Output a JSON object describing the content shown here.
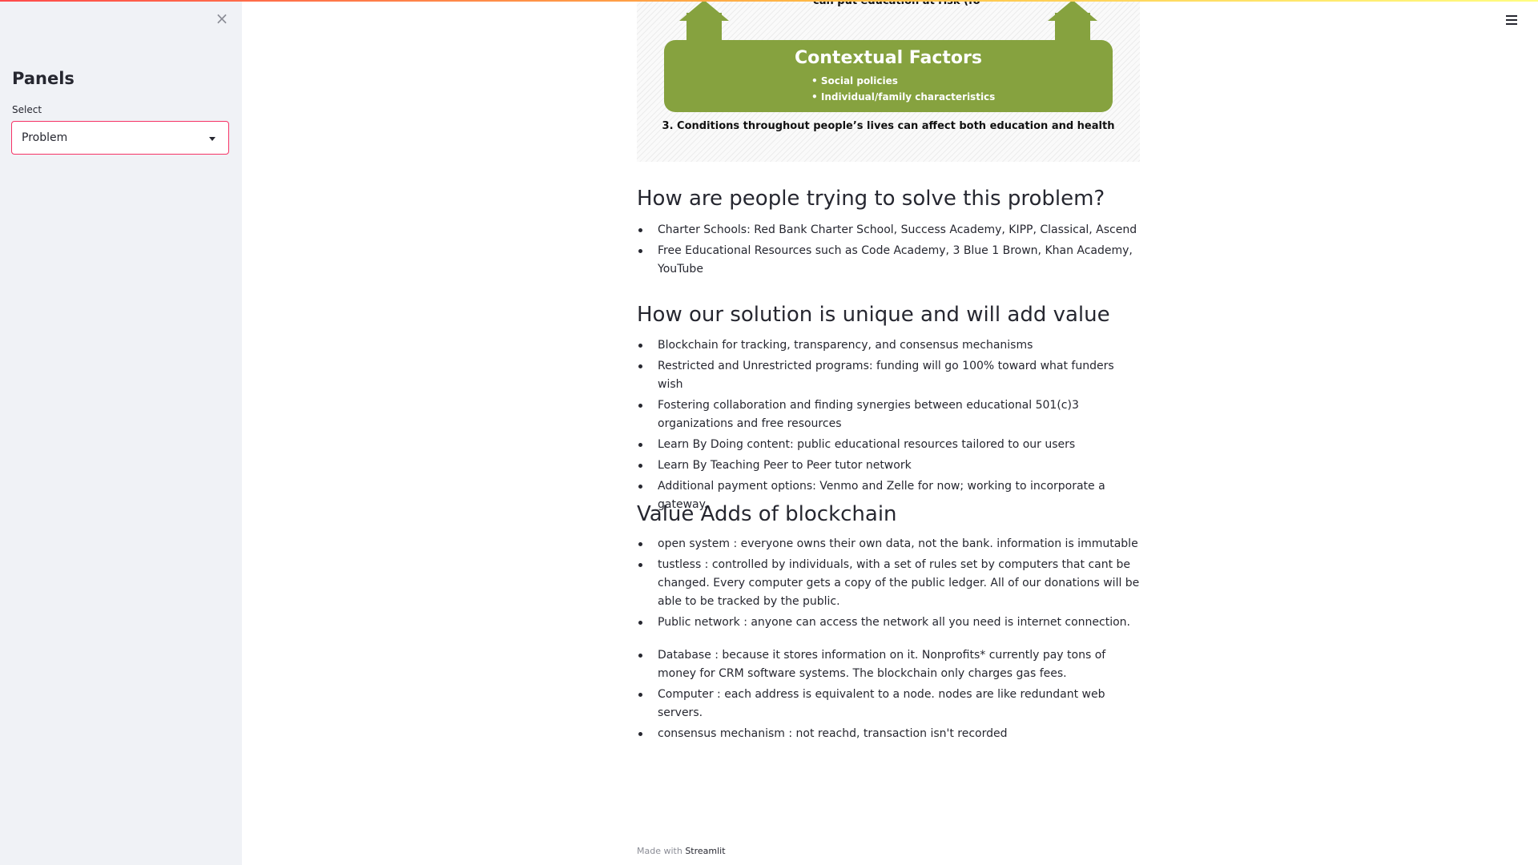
{
  "sidebar": {
    "close_icon": "×",
    "title": "Panels",
    "select_label": "Select",
    "select_value": "Problem"
  },
  "image": {
    "top_text": "can put education at risk (fo",
    "box_title": "Contextual Factors",
    "bullets": [
      "• Social policies",
      "• Individual/family characteristics"
    ],
    "caption": "3. Conditions throughout people’s lives can affect both education and health"
  },
  "sections": [
    {
      "heading": "How are people trying to solve this problem?",
      "items": [
        "Charter Schools: Red Bank Charter School, Success Academy, KIPP, Classical, Ascend",
        "Free Educational Resources such as Code Academy, 3 Blue 1 Brown, Khan Academy, YouTube"
      ]
    },
    {
      "heading": "How our solution is unique and will add value",
      "items": [
        "Blockchain for tracking, transparency, and consensus mechanisms",
        "Restricted and Unrestricted programs: funding will go 100% toward what funders wish",
        "Fostering collaboration and finding synergies between educational 501(c)3 organizations and free resources",
        "Learn By Doing content: public educational resources tailored to our users",
        "Learn By Teaching Peer to Peer tutor network",
        "Additional payment options: Venmo and Zelle for now; working to incorporate a gateway."
      ]
    },
    {
      "heading": "Value Adds of blockchain",
      "items": [
        "open system : everyone owns their own data, not the bank. information is immutable",
        "tustless : controlled by individuals, with a set of rules set by computers that cant be changed. Every computer gets a copy of the public ledger. All of our donations will be able to be tracked by the public.",
        "Public network : anyone can access the network all you need is internet connection."
      ],
      "items_b": [
        "Database : because it stores information on it. Nonprofits* currently pay tons of money for CRM software systems. The blockchain only charges gas fees.",
        "Computer : each address is equivalent to a node. nodes are like redundant web servers.",
        "consensus mechanism : not reachd, transaction isn't recorded"
      ]
    }
  ],
  "footer": {
    "prefix": "Made with",
    "link": "Streamlit"
  }
}
